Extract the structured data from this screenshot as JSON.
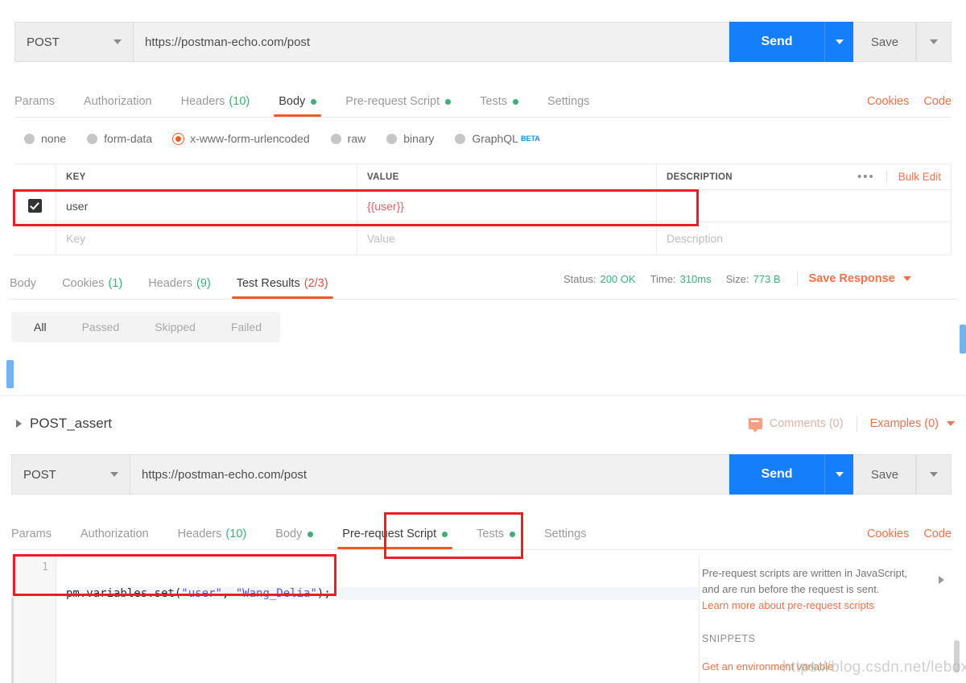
{
  "request_top": {
    "method": "POST",
    "url": "https://postman-echo.com/post",
    "send_label": "Send",
    "save_label": "Save"
  },
  "request_tabs_top": {
    "items": [
      {
        "label": "Params",
        "count": "",
        "dot": false,
        "active": false
      },
      {
        "label": "Authorization",
        "count": "",
        "dot": false,
        "active": false
      },
      {
        "label": "Headers",
        "count": "(10)",
        "dot": false,
        "active": false
      },
      {
        "label": "Body",
        "count": "",
        "dot": true,
        "active": true
      },
      {
        "label": "Pre-request Script",
        "count": "",
        "dot": true,
        "active": false
      },
      {
        "label": "Tests",
        "count": "",
        "dot": true,
        "active": false
      },
      {
        "label": "Settings",
        "count": "",
        "dot": false,
        "active": false
      }
    ],
    "cookies_label": "Cookies",
    "code_label": "Code"
  },
  "body_types": {
    "options": [
      {
        "label": "none",
        "selected": false
      },
      {
        "label": "form-data",
        "selected": false
      },
      {
        "label": "x-www-form-urlencoded",
        "selected": true
      },
      {
        "label": "raw",
        "selected": false
      },
      {
        "label": "binary",
        "selected": false
      },
      {
        "label": "GraphQL",
        "selected": false,
        "badge": "BETA"
      }
    ]
  },
  "kv_table": {
    "headers": {
      "key": "KEY",
      "value": "VALUE",
      "description": "DESCRIPTION"
    },
    "more_dots": "•••",
    "bulk_edit": "Bulk Edit",
    "rows": [
      {
        "checked": true,
        "key": "user",
        "value": "{{user}}",
        "description": ""
      }
    ],
    "placeholder_row": {
      "key": "Key",
      "value": "Value",
      "description": "Description"
    }
  },
  "response_tabs": {
    "items": [
      {
        "label": "Body",
        "count": "",
        "active": false
      },
      {
        "label": "Cookies",
        "count": "(1)",
        "active": false
      },
      {
        "label": "Headers",
        "count": "(9)",
        "active": false
      },
      {
        "label": "Test Results",
        "count": "(2/3)",
        "active": true
      }
    ],
    "meta": {
      "status_label": "Status:",
      "status_value": "200 OK",
      "time_label": "Time:",
      "time_value": "310ms",
      "size_label": "Size:",
      "size_value": "773 B",
      "save_response": "Save Response"
    }
  },
  "test_filters": {
    "items": [
      {
        "label": "All",
        "active": true
      },
      {
        "label": "Passed",
        "active": false
      },
      {
        "label": "Skipped",
        "active": false
      },
      {
        "label": "Failed",
        "active": false
      }
    ]
  },
  "collection": {
    "title": "POST_assert",
    "comments": "Comments (0)",
    "examples": "Examples (0)"
  },
  "request_bottom": {
    "method": "POST",
    "url": "https://postman-echo.com/post",
    "send_label": "Send",
    "save_label": "Save"
  },
  "request_tabs_bottom": {
    "items": [
      {
        "label": "Params",
        "count": "",
        "dot": false,
        "active": false
      },
      {
        "label": "Authorization",
        "count": "",
        "dot": false,
        "active": false
      },
      {
        "label": "Headers",
        "count": "(10)",
        "dot": false,
        "active": false
      },
      {
        "label": "Body",
        "count": "",
        "dot": true,
        "active": false
      },
      {
        "label": "Pre-request Script",
        "count": "",
        "dot": true,
        "active": true
      },
      {
        "label": "Tests",
        "count": "",
        "dot": true,
        "active": false
      },
      {
        "label": "Settings",
        "count": "",
        "dot": false,
        "active": false
      }
    ],
    "cookies_label": "Cookies",
    "code_label": "Code"
  },
  "editor": {
    "line_number": "1",
    "code_prefix": "pm.variables.set(",
    "code_arg1": "\"user\"",
    "code_mid": ", ",
    "code_arg2": "\"Wang_Delia\"",
    "code_suffix": ");"
  },
  "help_panel": {
    "line1": "Pre-request scripts are written in JavaScript,",
    "line2": "and are run before the request is sent.",
    "link": "Learn more about pre-request scripts",
    "snippets_title": "SNIPPETS",
    "snippet_1": "Get an environment variable"
  },
  "watermark": "https://blog.csdn.net/leboxy",
  "colors": {
    "accent_orange": "#f0724a",
    "active_underline": "#ef5b25",
    "send_blue": "#157efb",
    "green": "#3bb273",
    "annotation_red": "#ee1c24",
    "variable_red": "#ee5f5f",
    "beta_blue": "#1f8af5",
    "marker_blue": "#73b3ef"
  }
}
